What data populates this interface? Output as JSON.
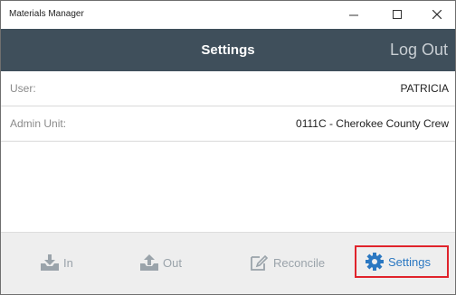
{
  "window": {
    "title": "Materials Manager",
    "minimize_glyph": "–",
    "maximize_glyph": "☐",
    "close_glyph": "✕"
  },
  "header": {
    "title": "Settings",
    "logout_label": "Log Out",
    "background": "#3f4f5b"
  },
  "fields": {
    "user": {
      "label": "User:",
      "value": "PATRICIA"
    },
    "admin_unit": {
      "label": "Admin Unit:",
      "value": "0111C - Cherokee County Crew"
    }
  },
  "nav": {
    "in": {
      "label": "In",
      "icon": "download-tray-icon"
    },
    "out": {
      "label": "Out",
      "icon": "upload-tray-icon"
    },
    "reconcile": {
      "label": "Reconcile",
      "icon": "edit-pencil-icon"
    },
    "settings": {
      "label": "Settings",
      "icon": "gear-icon",
      "active": true
    }
  },
  "colors": {
    "nav_inactive": "#9aa3aa",
    "nav_active": "#2b78c2",
    "highlight_border": "#e0232b"
  }
}
